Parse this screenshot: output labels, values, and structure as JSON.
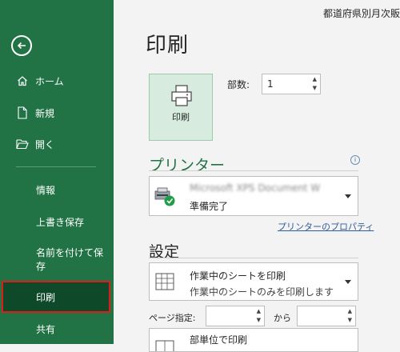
{
  "window": {
    "doc_title": "都道府県別月次販"
  },
  "sidebar": {
    "back_icon": "back-arrow-icon",
    "items": [
      {
        "label": "ホーム",
        "icon": "home-icon"
      },
      {
        "label": "新規",
        "icon": "new-document-icon"
      },
      {
        "label": "開く",
        "icon": "open-folder-icon"
      },
      {
        "label": "情報"
      },
      {
        "label": "上書き保存"
      },
      {
        "label": "名前を付けて保存"
      },
      {
        "label": "印刷"
      },
      {
        "label": "共有"
      }
    ],
    "active_item": "印刷"
  },
  "main": {
    "title": "印刷",
    "print_button": {
      "label": "印刷",
      "icon": "printer-icon"
    },
    "copies": {
      "label": "部数:",
      "value": "1"
    },
    "printer_section": {
      "title": "プリンター",
      "printer_name": "Microsoft XPS Document W",
      "status": "準備完了",
      "properties_link": "プリンターのプロパティ"
    },
    "settings_section": {
      "title": "設定",
      "print_what": {
        "title": "作業中のシートを印刷",
        "description": "作業中のシートのみを印刷します"
      },
      "pages_label": "ページ指定:",
      "to_label": "から",
      "collation": {
        "title": "部単位で印刷"
      }
    }
  },
  "colors": {
    "accent": "#217346",
    "active_nav": "#0e4a2a",
    "active_border": "#e01b1b",
    "link": "#2e5c9a"
  }
}
